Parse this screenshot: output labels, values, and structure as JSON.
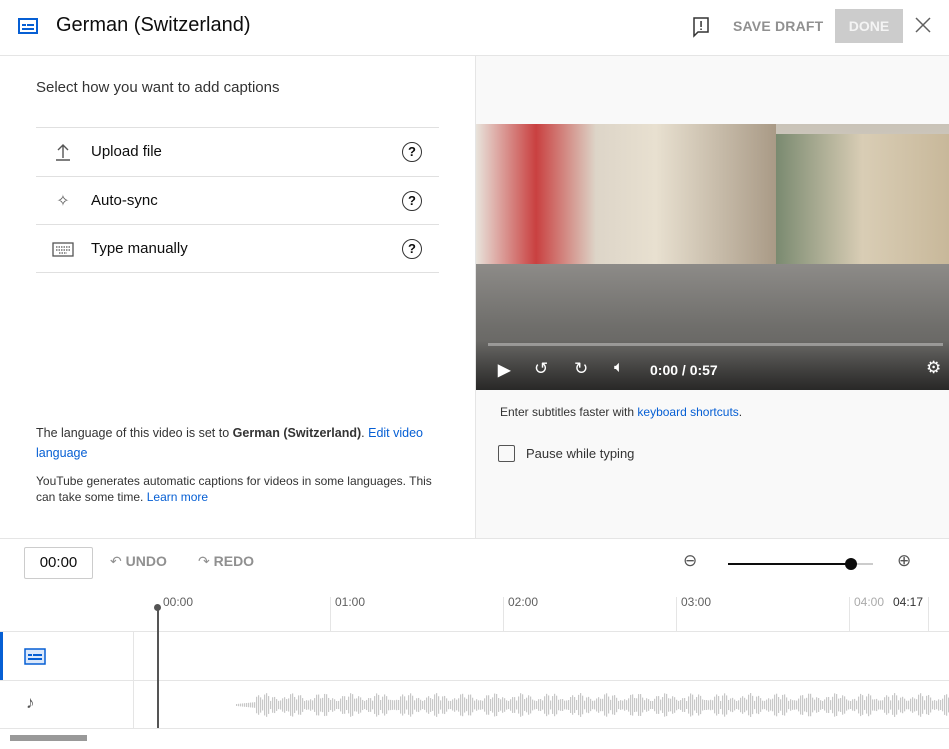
{
  "header": {
    "title": "German (Switzerland)",
    "save_draft": "SAVE DRAFT",
    "done": "DONE"
  },
  "left": {
    "prompt": "Select how you want to add captions",
    "options": [
      {
        "label": "Upload file",
        "icon": "upload-icon"
      },
      {
        "label": "Auto-sync",
        "icon": "sparkle-icon"
      },
      {
        "label": "Type manually",
        "icon": "keyboard-icon"
      }
    ],
    "lang_text_pre": "The language of this video is set to ",
    "lang_name": "German (Switzerland)",
    "lang_text_post": ". ",
    "edit_link": "Edit video language",
    "auto_text": "YouTube generates automatic captions for videos in some languages. This can take some time. ",
    "learn_more": "Learn more"
  },
  "right": {
    "time": "0:00 / 0:57",
    "hint_pre": "Enter subtitles faster with ",
    "hint_link": "keyboard shortcuts",
    "hint_post": ".",
    "pause_label": "Pause while typing",
    "pause_checked": false
  },
  "timeline": {
    "current": "00:00",
    "undo": "UNDO",
    "redo": "REDO",
    "zoom_level": 0.85,
    "ticks": [
      "00:00",
      "01:00",
      "02:00",
      "03:00",
      "04:00"
    ],
    "end": "04:17"
  },
  "colors": {
    "accent": "#065fd4",
    "done_bg": "#cccccc"
  }
}
